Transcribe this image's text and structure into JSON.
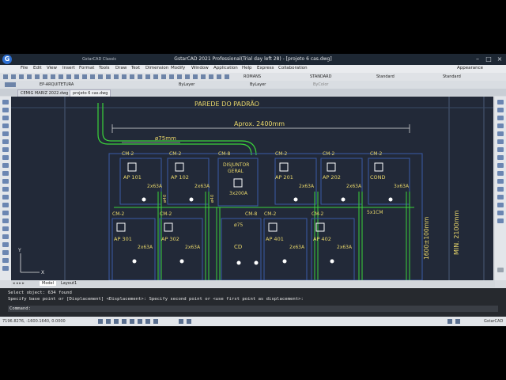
{
  "app": {
    "title": "GstarCAD 2021 Professional(Trial day left 28) - [projeto 6 cas.dwg]",
    "workspace": "GstarCAD Classic",
    "appearance": "Appearance"
  },
  "menu": [
    "File",
    "Edit",
    "View",
    "Insert",
    "Format",
    "Tools",
    "Draw",
    "Text",
    "Dimension",
    "Modify",
    "Window",
    "Application",
    "Help",
    "Express",
    "Collaboration"
  ],
  "ribbon": {
    "font_style": "ROMANS",
    "dim_style": "STANDARD",
    "table_style": "Standard",
    "multileader_style": "Standard"
  },
  "layerbar": {
    "layer": "EP-ARQUITETURA",
    "color": "ByLayer",
    "linetype": "ByLayer",
    "lineweight": "ByColor"
  },
  "doc_tabs": [
    "CEMIG MARIZ 2022.dwg",
    "projeto 6 cas.dwg"
  ],
  "layout_tabs": [
    "Model",
    "Layout1"
  ],
  "command": {
    "line1": "Select object:  634 found",
    "line2": "Specify base point or [Displacement] <Displacement>: Specify second point or <use first point as displacement>:",
    "line3": "Command:"
  },
  "status": {
    "coords": "7196.8276, -1600.1640, 0.0000",
    "brand": "GstarCAD"
  },
  "drawing": {
    "wall_title": "PAREDE DO PADRÃO",
    "approx": "Aprox. 2400mm",
    "diam": "ø75mm",
    "min": "MIN. 2100mm",
    "height_dim": "1600±100mm",
    "cable": "5x1CM",
    "disjuntor_lines": [
      "DISJUNTOR",
      "GERAL"
    ],
    "disjuntor_rating": "3x200A",
    "cm8": "CM-8",
    "cm2": "CM-2",
    "diam75": "ø75",
    "cd": "CD",
    "row1": [
      {
        "name": "AP 101",
        "rating": "2x63A"
      },
      {
        "name": "AP 102",
        "rating": "2x63A"
      },
      {
        "name": "AP 201",
        "rating": "2x63A"
      },
      {
        "name": "AP 202",
        "rating": "2x63A"
      },
      {
        "name": "COND",
        "rating": "3x63A"
      }
    ],
    "row2": [
      {
        "name": "AP 301",
        "rating": "2x63A"
      },
      {
        "name": "AP 302",
        "rating": "2x63A"
      },
      {
        "name": "AP 401",
        "rating": "2x63A"
      },
      {
        "name": "AP 402",
        "rating": "2x63A"
      }
    ],
    "conduit": "ø40"
  }
}
